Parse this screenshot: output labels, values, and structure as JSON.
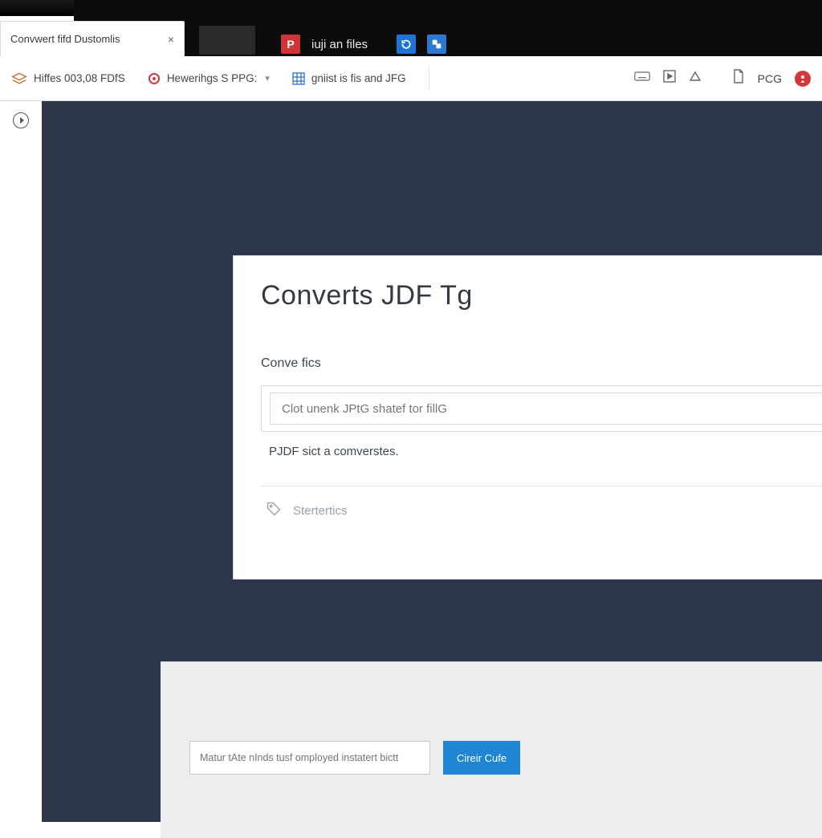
{
  "tab": {
    "title": "Convwert fifd Dustomlis"
  },
  "topbar": {
    "p_icon_letter": "P",
    "label1": "iuji an files"
  },
  "toolbar": {
    "item1": "Hiffes 003,08 FDfS",
    "item2": "Hewerihgs S PPG:",
    "item3": "gniist is fis and JFG",
    "item4": "PCG"
  },
  "card": {
    "heading": "Converts JDF Tg",
    "section_label": "Conve fics",
    "input_placeholder": "Clot unenk JPtG shatef tor fillG",
    "hint": "PJDF sict a comverstes.",
    "settings_label": "Stertertics"
  },
  "bottom": {
    "input_placeholder": "Matur tAte nInds tusf omployed instatert bictt",
    "button": "Cireir Cufe"
  }
}
